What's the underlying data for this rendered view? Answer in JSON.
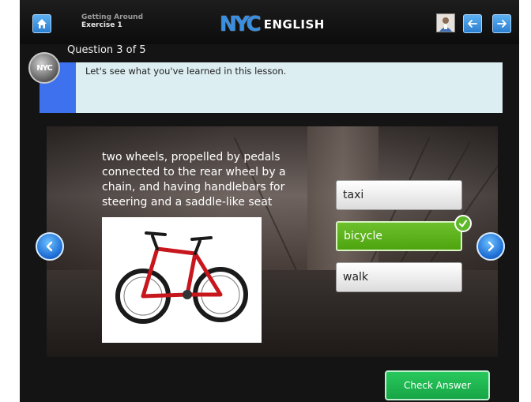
{
  "breadcrumb": {
    "line1": "Getting Around",
    "line2": "Exercise 1"
  },
  "logo": {
    "mark": "NYC",
    "word": "ENGLISH"
  },
  "badge": {
    "text": "NYC"
  },
  "question": {
    "header": "Question 3 of 5",
    "instruction": "Let's see what you've learned in this lesson."
  },
  "clue": "two wheels, propelled by pedals connected to the rear wheel by a chain, and having handlebars for steering and a saddle-like seat",
  "choices": [
    {
      "label": "taxi",
      "selected": false
    },
    {
      "label": "bicycle",
      "selected": true
    },
    {
      "label": "walk",
      "selected": false
    }
  ],
  "check_answer_label": "Check Answer",
  "colors": {
    "accent_blue": "#3e71ee",
    "selected_green": "#4ea40f",
    "check_green": "#17a546",
    "instruction_bg": "#dceef2"
  },
  "icons": [
    "home-icon",
    "profile-icon",
    "arrow-left-icon",
    "arrow-right-icon",
    "chevron-left-icon",
    "chevron-right-icon",
    "checkmark-icon"
  ]
}
